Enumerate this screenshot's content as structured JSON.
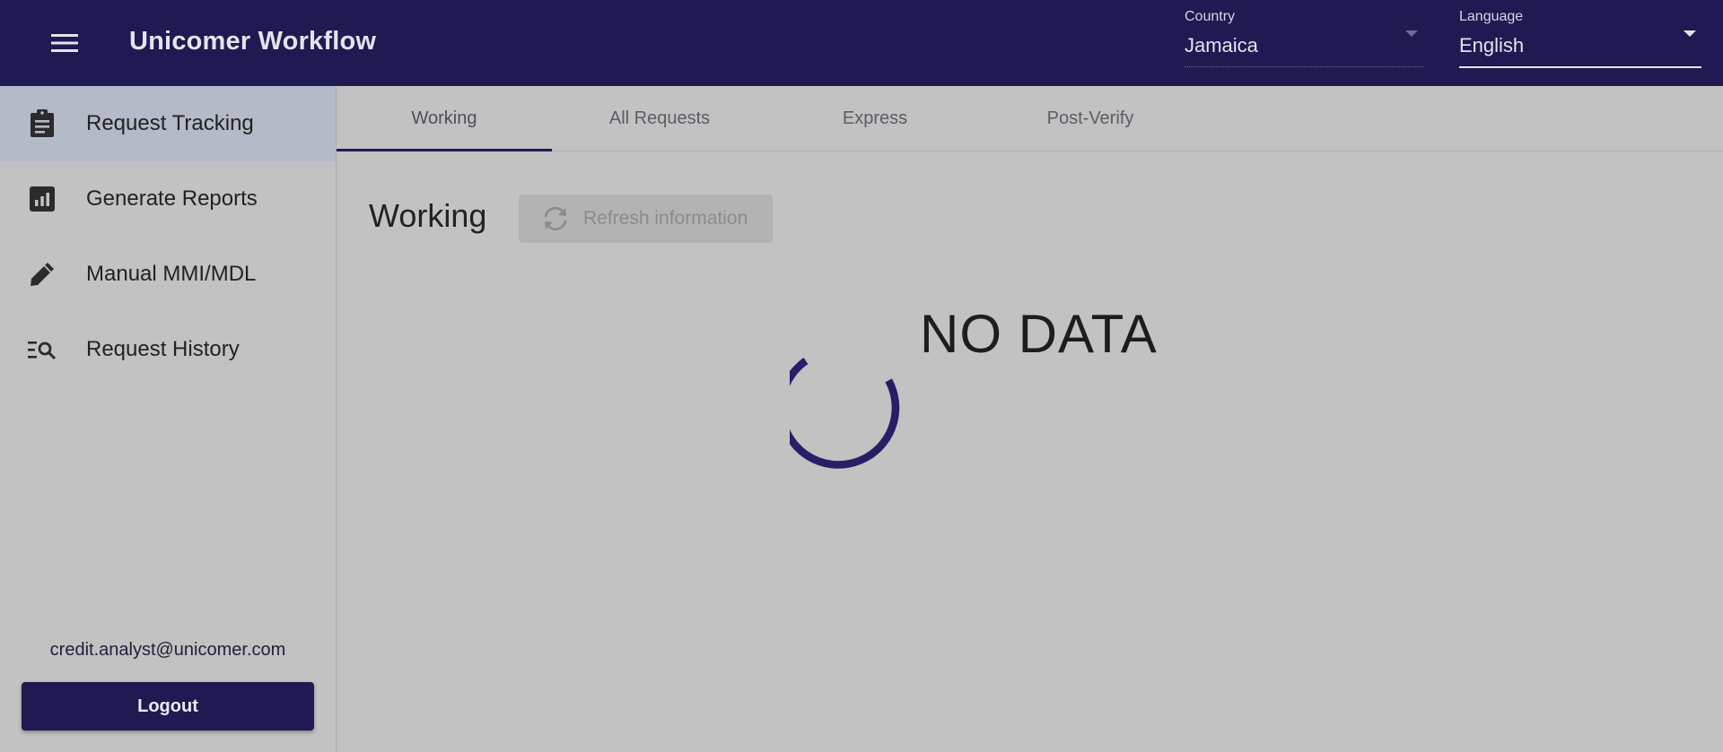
{
  "app": {
    "title": "Unicomer Workflow",
    "accent_color": "#1f1a52",
    "menu_icon": "menu-icon"
  },
  "header": {
    "country": {
      "label": "Country",
      "value": "Jamaica"
    },
    "language": {
      "label": "Language",
      "value": "English"
    }
  },
  "sidebar": {
    "items": [
      {
        "label": "Request Tracking",
        "icon": "clipboard-icon",
        "active": true
      },
      {
        "label": "Generate Reports",
        "icon": "bar-chart-icon",
        "active": false
      },
      {
        "label": "Manual MMI/MDL",
        "icon": "pencil-icon",
        "active": false
      },
      {
        "label": "Request History",
        "icon": "list-search-icon",
        "active": false
      }
    ],
    "user_email": "credit.analyst@unicomer.com",
    "logout_label": "Logout"
  },
  "main": {
    "tabs": [
      {
        "label": "Working",
        "active": true
      },
      {
        "label": "All Requests",
        "active": false
      },
      {
        "label": "Express",
        "active": false
      },
      {
        "label": "Post-Verify",
        "active": false
      }
    ],
    "section_title": "Working",
    "refresh_label": "Refresh information",
    "refresh_icon": "refresh-icon",
    "empty_message": "NO DATA",
    "loading_spinner": true
  }
}
